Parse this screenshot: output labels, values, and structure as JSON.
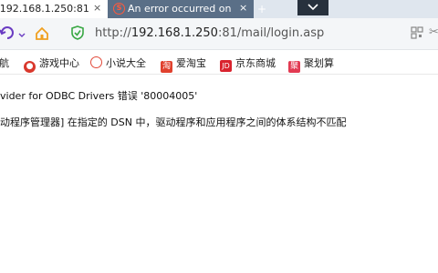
{
  "tabs": [
    {
      "label": "/192.168.1.250:81",
      "close": "×"
    },
    {
      "label": "An error occurred on",
      "close": "×"
    }
  ],
  "new_tab_symbol": "+",
  "dropdown_symbol": "⌄",
  "address_bar": {
    "scheme": "http://",
    "host": "192.168.1.250",
    "path": ":81/mail/login.asp"
  },
  "bookmarks": [
    {
      "label": "航",
      "icon": "",
      "color": "#ffffff"
    },
    {
      "label": "游戏中心",
      "icon": "●",
      "color": "#d9382c"
    },
    {
      "label": "小说大全",
      "icon": "○",
      "color": "#e24a3a"
    },
    {
      "label": "爱淘宝",
      "icon": "淘",
      "color": "#e0412e"
    },
    {
      "label": "京东商城",
      "icon": "JD",
      "color": "#d9232e"
    },
    {
      "label": "聚划算",
      "icon": "聚",
      "color": "#e23a52"
    }
  ],
  "content": {
    "line1": "vider for ODBC Drivers 错误 '80004005'",
    "line2": "动程序管理器] 在指定的 DSN 中，驱动程序和应用程序之间的体系结构不匹配"
  },
  "colors": {
    "accent_back": "#6a3cc2",
    "home": "#f0a020",
    "shield": "#3aa845"
  }
}
